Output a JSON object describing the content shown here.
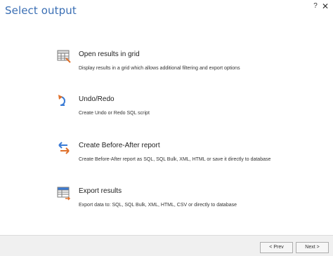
{
  "window": {
    "title": "Select output",
    "help_label": "?",
    "close_label": "✕"
  },
  "options": [
    {
      "title": "Open results in grid",
      "description": "Display results in a grid which allows additional filtering and export options",
      "icon": "grid-icon"
    },
    {
      "title": "Undo/Redo",
      "description": "Create Undo or Redo SQL script",
      "icon": "undo-redo-icon"
    },
    {
      "title": "Create Before-After report",
      "description": "Create Before-After report as SQL, SQL Bulk, XML, HTML or save it directly to database",
      "icon": "before-after-icon"
    },
    {
      "title": "Export results",
      "description": "Export data to: SQL, SQL Bulk, XML, HTML, CSV or directly to database",
      "icon": "export-icon"
    }
  ],
  "footer": {
    "prev_label": "< Prev",
    "next_label": "Next >"
  },
  "colors": {
    "title": "#3b6fb4",
    "accent_orange": "#e0702a",
    "accent_blue": "#3a7bd5"
  }
}
